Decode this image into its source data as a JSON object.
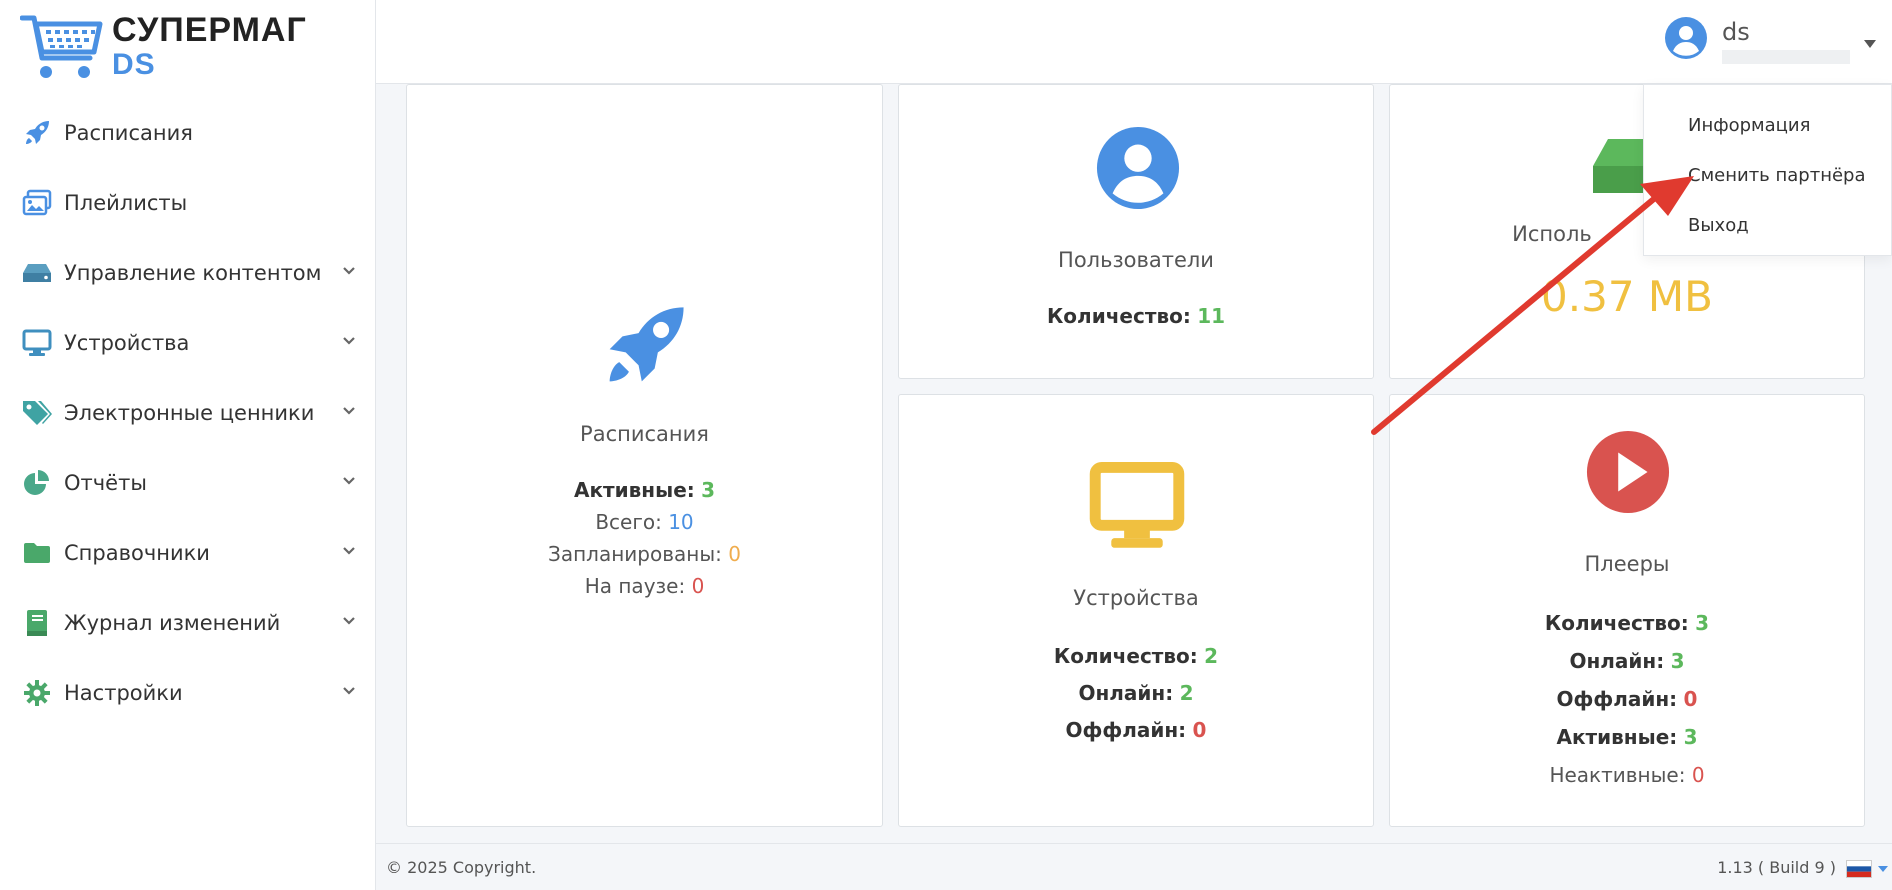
{
  "brand": {
    "line1": "СУПЕРМАГ",
    "line2": "DS",
    "color": "#4a90e2"
  },
  "sidebar": {
    "items": [
      {
        "label": "Расписания",
        "icon": "rocket-icon",
        "expandable": false
      },
      {
        "label": "Плейлисты",
        "icon": "images-icon",
        "expandable": false
      },
      {
        "label": "Управление контентом",
        "icon": "hdd-icon",
        "expandable": true
      },
      {
        "label": "Устройства",
        "icon": "monitor-icon",
        "expandable": true
      },
      {
        "label": "Электронные ценники",
        "icon": "tags-icon",
        "expandable": true
      },
      {
        "label": "Отчёты",
        "icon": "pie-chart-icon",
        "expandable": true
      },
      {
        "label": "Справочники",
        "icon": "folder-icon",
        "expandable": true
      },
      {
        "label": "Журнал изменений",
        "icon": "book-icon",
        "expandable": true
      },
      {
        "label": "Настройки",
        "icon": "gear-icon",
        "expandable": true
      }
    ]
  },
  "header": {
    "user_name": "ds"
  },
  "dropdown": {
    "items": [
      {
        "label": "Информация"
      },
      {
        "label": "Сменить партнёра"
      },
      {
        "label": "Выход"
      }
    ]
  },
  "cards": {
    "schedules": {
      "title": "Расписания",
      "active_label": "Активные:",
      "active_value": "3",
      "total_label": "Всего:",
      "total_value": "10",
      "planned_label": "Запланированы:",
      "planned_value": "0",
      "paused_label": "На паузе:",
      "paused_value": "0"
    },
    "users": {
      "title": "Пользователи",
      "count_label": "Количество:",
      "count_value": "11"
    },
    "storage": {
      "title": "Исполь",
      "value": "0.37 MB"
    },
    "devices": {
      "title": "Устройства",
      "count_label": "Количество:",
      "count_value": "2",
      "online_label": "Онлайн:",
      "online_value": "2",
      "offline_label": "Оффлайн:",
      "offline_value": "0"
    },
    "players": {
      "title": "Плееры",
      "count_label": "Количество:",
      "count_value": "3",
      "online_label": "Онлайн:",
      "online_value": "3",
      "offline_label": "Оффлайн:",
      "offline_value": "0",
      "active_label": "Активные:",
      "active_value": "3",
      "inactive_label": "Неактивные:",
      "inactive_value": "0"
    }
  },
  "footer": {
    "copyright": "© 2025 Copyright.",
    "version": "1.13 ( Build 9 )"
  },
  "colors": {
    "green": "#5cb85c",
    "blue": "#4a90e2",
    "yellow": "#f0c040",
    "red": "#d9534f",
    "arrow": "#e03a2f"
  }
}
